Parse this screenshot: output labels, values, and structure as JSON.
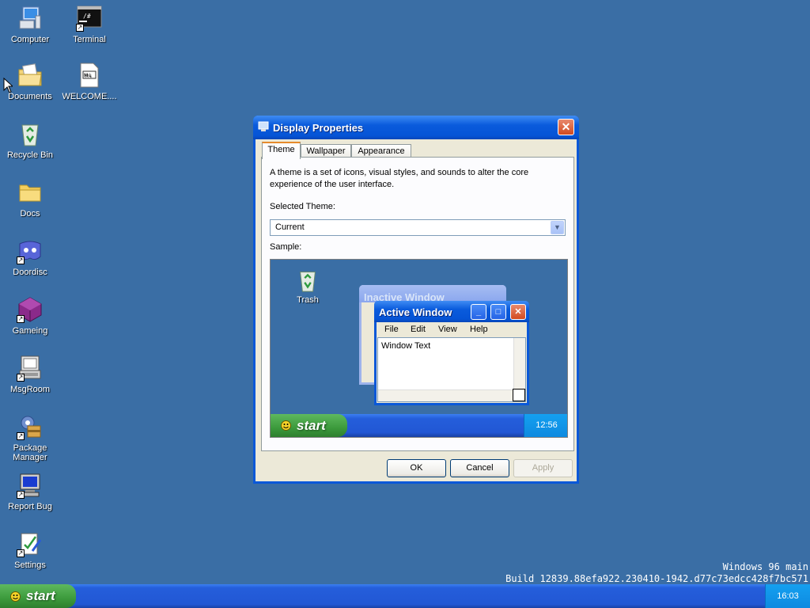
{
  "desktop": {
    "icons": [
      {
        "label": "Computer",
        "icon": "computer-icon",
        "shortcut": false
      },
      {
        "label": "Terminal",
        "icon": "terminal-icon",
        "shortcut": true
      },
      {
        "label": "Documents",
        "icon": "documents-icon",
        "shortcut": false
      },
      {
        "label": "WELCOME....",
        "icon": "markdown-file-icon",
        "shortcut": false
      },
      {
        "label": "Recycle Bin",
        "icon": "recycle-bin-icon",
        "shortcut": false
      },
      {
        "label": "Docs",
        "icon": "folder-icon",
        "shortcut": false
      },
      {
        "label": "Doordisc",
        "icon": "doordisc-icon",
        "shortcut": true
      },
      {
        "label": "Gameing",
        "icon": "gameing-icon",
        "shortcut": true
      },
      {
        "label": "MsgRoom",
        "icon": "msgroom-icon",
        "shortcut": true
      },
      {
        "label": "Package Manager",
        "icon": "package-manager-icon",
        "shortcut": true
      },
      {
        "label": "Report Bug",
        "icon": "report-bug-icon",
        "shortcut": true
      },
      {
        "label": "Settings",
        "icon": "settings-icon",
        "shortcut": true
      }
    ]
  },
  "dialog": {
    "title": "Display Properties",
    "close": "✕",
    "tabs": [
      "Theme",
      "Wallpaper",
      "Appearance"
    ],
    "active_tab": "Theme",
    "description": "A theme is a set of icons, visual styles, and sounds to alter the core experience of the user interface.",
    "selected_theme_label": "Selected Theme:",
    "selected_theme_value": "Current",
    "sample_label": "Sample:",
    "buttons": {
      "ok": "OK",
      "cancel": "Cancel",
      "apply": "Apply"
    }
  },
  "sample": {
    "trash_label": "Trash",
    "inactive_title": "Inactive Window",
    "active_title": "Active Window",
    "menu": [
      "File",
      "Edit",
      "View",
      "Help"
    ],
    "window_text": "Window Text",
    "start_label": "start",
    "clock": "12:56"
  },
  "build": {
    "line1": "Windows 96 main",
    "line2": "Build 12839.88efa922.230410-1942.d77c73edcc428f7bc571"
  },
  "taskbar": {
    "start_label": "start",
    "clock": "16:03"
  },
  "colors": {
    "desktop": "#3a6ea5",
    "titlebar": "#0a5bdc",
    "start_green": "#3c9a3c",
    "tray": "#0e8ae0"
  }
}
